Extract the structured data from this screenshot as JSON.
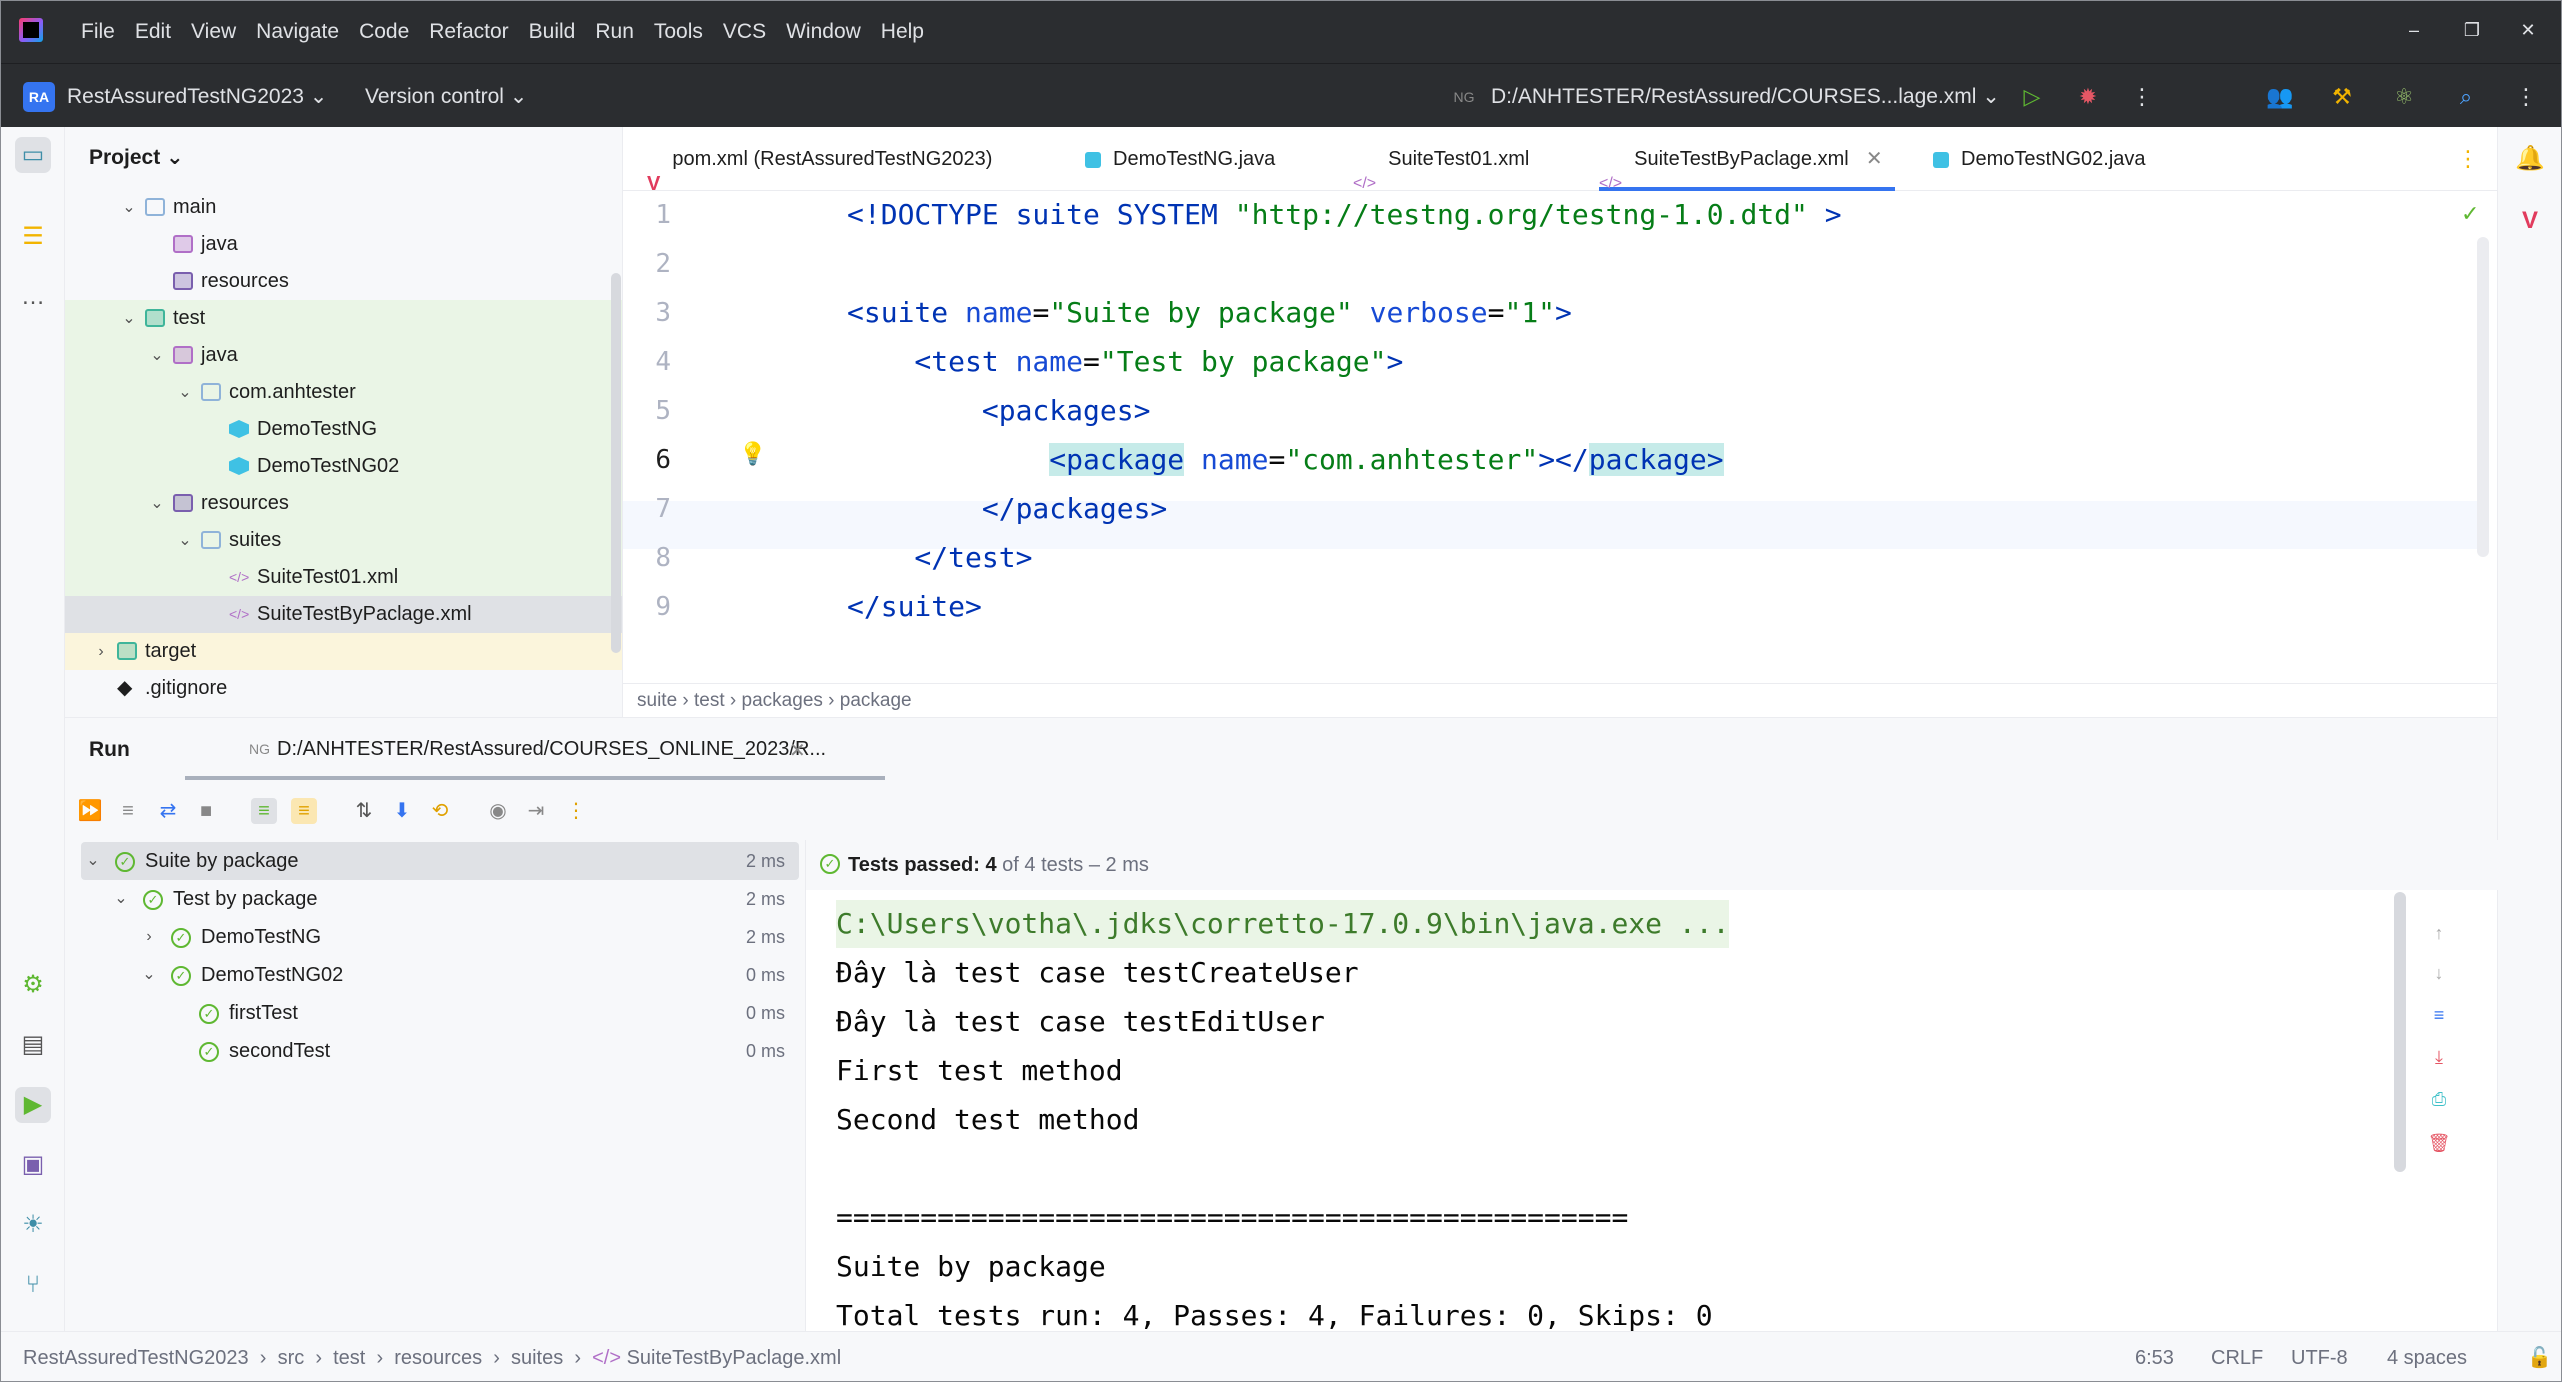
{
  "window": {
    "menu": [
      "File",
      "Edit",
      "View",
      "Navigate",
      "Code",
      "Refactor",
      "Build",
      "Run",
      "Tools",
      "VCS",
      "Window",
      "Help"
    ]
  },
  "toolbar": {
    "project_badge": "RA",
    "project_name": "RestAssuredTestNG2023 ⌄",
    "vcs": "Version control ⌄",
    "run_config": "D:/ANHTESTER/RestAssured/COURSES...lage.xml ⌄"
  },
  "project_panel": {
    "title": "Project ⌄",
    "tree": [
      {
        "label": "main",
        "depth": 2,
        "arrow": "⌄",
        "icon": "folder"
      },
      {
        "label": "java",
        "depth": 3,
        "arrow": "",
        "icon": "source-folder"
      },
      {
        "label": "resources",
        "depth": 3,
        "arrow": "",
        "icon": "resources-folder"
      },
      {
        "label": "test",
        "depth": 2,
        "arrow": "⌄",
        "icon": "test-folder"
      },
      {
        "label": "java",
        "depth": 3,
        "arrow": "⌄",
        "icon": "test-source-folder"
      },
      {
        "label": "com.anhtester",
        "depth": 4,
        "arrow": "⌄",
        "icon": "package"
      },
      {
        "label": "DemoTestNG",
        "depth": 5,
        "arrow": "",
        "icon": "class"
      },
      {
        "label": "DemoTestNG02",
        "depth": 5,
        "arrow": "",
        "icon": "class"
      },
      {
        "label": "resources",
        "depth": 3,
        "arrow": "⌄",
        "icon": "resources-folder"
      },
      {
        "label": "suites",
        "depth": 4,
        "arrow": "⌄",
        "icon": "folder"
      },
      {
        "label": "SuiteTest01.xml",
        "depth": 5,
        "arrow": "",
        "icon": "xml-file"
      },
      {
        "label": "SuiteTestByPaclage.xml",
        "depth": 5,
        "arrow": "",
        "icon": "xml-file"
      },
      {
        "label": "target",
        "depth": 1,
        "arrow": "›",
        "icon": "excluded-folder"
      },
      {
        "label": ".gitignore",
        "depth": 1,
        "arrow": "",
        "icon": "git-file"
      }
    ]
  },
  "editor": {
    "tabs": [
      {
        "label": "pom.xml (RestAssuredTestNG2023)",
        "icon": "maven"
      },
      {
        "label": "DemoTestNG.java",
        "icon": "class"
      },
      {
        "label": "SuiteTest01.xml",
        "icon": "xml"
      },
      {
        "label": "SuiteTestByPaclage.xml",
        "icon": "xml"
      },
      {
        "label": "DemoTestNG02.java",
        "icon": "class"
      }
    ],
    "line_numbers": [
      "1",
      "2",
      "3",
      "4",
      "5",
      "6",
      "7",
      "8",
      "9"
    ],
    "code": {
      "l1_a": "<!DOCTYPE",
      "l1_b": " suite SYSTEM ",
      "l1_c": "\"http://testng.org/testng-1.0.dtd\"",
      "l1_d": " >",
      "l3_a": "<suite ",
      "l3_b": "name",
      "l3_c": "=",
      "l3_d": "\"Suite by package\"",
      "l3_e": " verbose",
      "l3_f": "=",
      "l3_g": "\"1\"",
      "l3_h": ">",
      "l4_a": "    <test ",
      "l4_b": "name",
      "l4_c": "=",
      "l4_d": "\"Test by package\"",
      "l4_e": ">",
      "l5_a": "        <packages>",
      "l6_indent": "            ",
      "l6_a": "<package",
      "l6_b": " name",
      "l6_c": "=",
      "l6_d": "\"com.anhtester\"",
      "l6_e": "></",
      "l6_f": "package",
      "l6_g": ">",
      "l7_a": "        </packages>",
      "l8_a": "    </test>",
      "l9_a": "</suite>"
    },
    "breadcrumb": [
      "suite",
      "test",
      "packages",
      "package"
    ]
  },
  "run": {
    "title": "Run",
    "tab_label": "D:/ANHTESTER/RestAssured/COURSES_ONLINE_2023/R...",
    "tests": [
      {
        "label": "Suite by package",
        "time": "2 ms",
        "depth": 0,
        "arrow": "⌄"
      },
      {
        "label": "Test by package",
        "time": "2 ms",
        "depth": 1,
        "arrow": "⌄"
      },
      {
        "label": "DemoTestNG",
        "time": "2 ms",
        "depth": 2,
        "arrow": "›"
      },
      {
        "label": "DemoTestNG02",
        "time": "0 ms",
        "depth": 2,
        "arrow": "⌄"
      },
      {
        "label": "firstTest",
        "time": "0 ms",
        "depth": 3,
        "arrow": ""
      },
      {
        "label": "secondTest",
        "time": "0 ms",
        "depth": 3,
        "arrow": ""
      }
    ],
    "status_strong": "Tests passed: 4",
    "status_rest": " of 4 tests – 2 ms",
    "console": [
      "C:\\Users\\votha\\.jdks\\corretto-17.0.9\\bin\\java.exe ...",
      "Đây là test case testCreateUser",
      "Đây là test case testEditUser",
      "First test method",
      "Second test method",
      "",
      "===============================================",
      "Suite by package",
      "Total tests run: 4, Passes: 4, Failures: 0, Skips: 0"
    ]
  },
  "statusbar": {
    "path": [
      "RestAssuredTestNG2023",
      "src",
      "test",
      "resources",
      "suites",
      "SuiteTestByPaclage.xml"
    ],
    "position": "6:53",
    "line_sep": "CRLF",
    "encoding": "UTF-8",
    "indent": "4 spaces"
  },
  "colors": {
    "accent": "#3574f0",
    "pass": "#5fb832",
    "tag": "#0033b3",
    "string": "#067d17"
  }
}
